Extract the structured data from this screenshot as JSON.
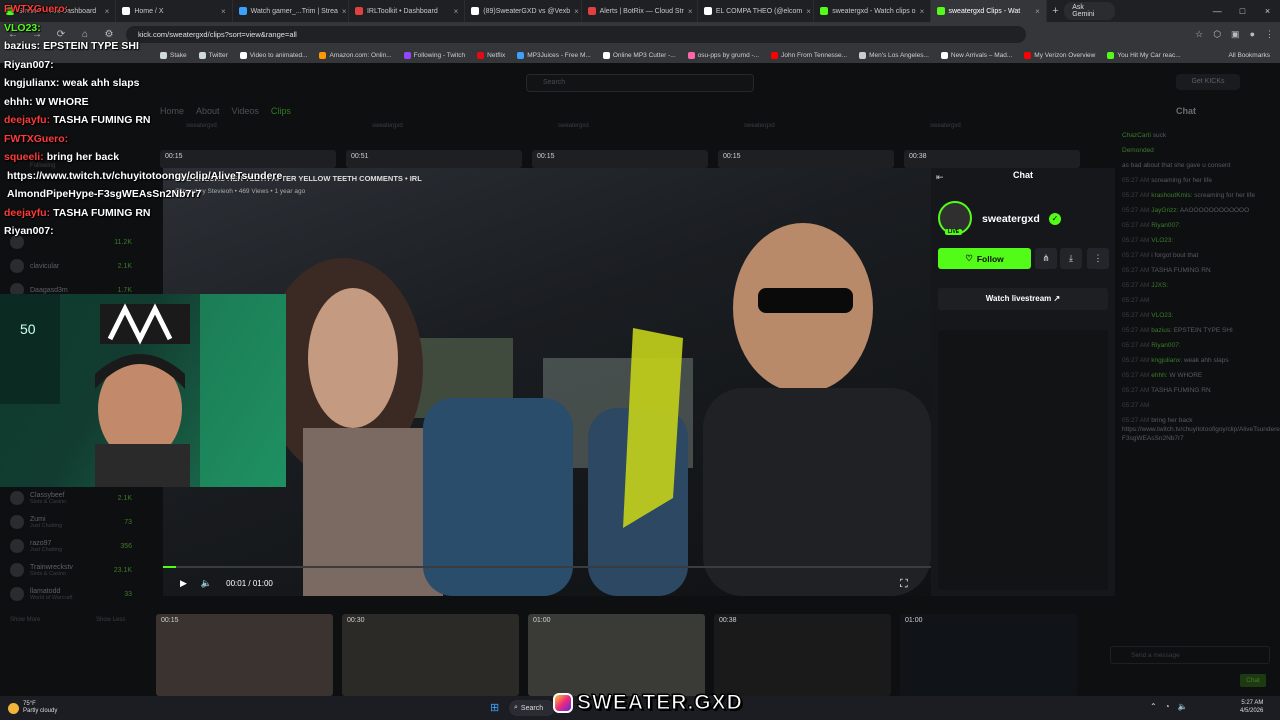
{
  "browser": {
    "tabs": [
      {
        "label": "Stream - Kick Dashboard",
        "color": "#53fc18"
      },
      {
        "label": "Home / X",
        "color": "#ffffff"
      },
      {
        "label": "Watch gamer_...Trim | Strea",
        "color": "#3aa1ff"
      },
      {
        "label": "IRLToolkit • Dashboard",
        "color": "#e04040"
      },
      {
        "label": "(89)SweaterGXD vs @Vexb",
        "color": "#ffffff"
      },
      {
        "label": "Alerts | BotRix — Cloud Str",
        "color": "#e04040"
      },
      {
        "label": "EL COMPA THEO (@elcom",
        "color": "#ffffff"
      },
      {
        "label": "sweatergxd - Watch clips o",
        "color": "#53fc18"
      },
      {
        "label": "sweatergxd Clips - Wat",
        "color": "#53fc18"
      }
    ],
    "ask_gemini": "Ask Gemini",
    "url": "kick.com/sweatergxd/clips?sort=view&range=all",
    "bookmarks": [
      {
        "label": "Stake",
        "color": "#cfd8dc"
      },
      {
        "label": "Twitter",
        "color": "#cfd8dc"
      },
      {
        "label": "Video to animated...",
        "color": "#ffffff"
      },
      {
        "label": "Amazon.com: Onlin...",
        "color": "#ff9900"
      },
      {
        "label": "Following - Twitch",
        "color": "#9146ff"
      },
      {
        "label": "Netflix",
        "color": "#e50914"
      },
      {
        "label": "MP3Juices - Free M...",
        "color": "#3aa1ff"
      },
      {
        "label": "Online MP3 Cutter -...",
        "color": "#ffffff"
      },
      {
        "label": "osu-pps by grumd -...",
        "color": "#ff66aa"
      },
      {
        "label": "John From Tennesse...",
        "color": "#ff0000"
      },
      {
        "label": "Men's Los Angeles...",
        "color": "#cccccc"
      },
      {
        "label": "New Arrivals – Mad...",
        "color": "#ffffff"
      },
      {
        "label": "My Verizon Overview",
        "color": "#ff0000"
      },
      {
        "label": "You Hit My Car reac...",
        "color": "#53fc18"
      }
    ],
    "all_bookmarks": "All Bookmarks"
  },
  "kick": {
    "search_placeholder": "Search",
    "get_kicks": "Get KICKs",
    "nav": [
      "Home",
      "About",
      "Videos",
      "Clips"
    ],
    "chat_title": "Chat",
    "browse": "Browse",
    "following": "Following",
    "top_thumbs": [
      {
        "duration": "00:15",
        "channel": "sweatergxd"
      },
      {
        "duration": "00:51",
        "channel": "sweatergxd"
      },
      {
        "duration": "00:15",
        "channel": "sweatergxd"
      },
      {
        "duration": "00:15",
        "channel": "sweatergxd"
      },
      {
        "duration": "00:38",
        "channel": "sweatergxd"
      }
    ],
    "bottom_thumbs": [
      {
        "duration": "00:15"
      },
      {
        "duration": "00:30"
      },
      {
        "duration": "01:00"
      },
      {
        "duration": "00:38"
      },
      {
        "duration": "01:00"
      }
    ],
    "sidebar": [
      {
        "name": "",
        "count": "11.2K",
        "sub": ""
      },
      {
        "name": "clavicular",
        "count": "2.1K",
        "sub": ""
      },
      {
        "name": "Daagasd3m",
        "count": "1.7K",
        "sub": ""
      },
      {
        "name": "Classybeef",
        "count": "2.1K",
        "sub": "Slots & Casino"
      },
      {
        "name": "Zumi",
        "count": "73",
        "sub": "Just Chatting"
      },
      {
        "name": "razo97",
        "count": "356",
        "sub": "Just Chatting"
      },
      {
        "name": "Trainwreckstv",
        "count": "23.1K",
        "sub": "Slots & Casino"
      },
      {
        "name": "llamatodd",
        "count": "33",
        "sub": "World of Warcraft"
      }
    ],
    "show_more": "Show More",
    "show_less": "Show Less"
  },
  "overlay_chat": [
    {
      "user": "FWTXGuero:",
      "msg": "",
      "color": "#ff3b3b"
    },
    {
      "user": "VLO23:",
      "msg": "",
      "color": "#53fc18"
    },
    {
      "user": "bazius:",
      "msg": "EPSTEIN TYPE SHI",
      "color": "#ffffff"
    },
    {
      "user": "Riyan007:",
      "msg": "",
      "color": "#ffffff"
    },
    {
      "user": "kngjulianx:",
      "msg": "weak ahh slaps",
      "color": "#ffffff"
    },
    {
      "user": "ehhh:",
      "msg": "W WHORE",
      "color": "#ffffff"
    },
    {
      "user": "deejayfu:",
      "msg": "TASHA FUMING RN",
      "color": "#ff3b3b"
    },
    {
      "user": "FWTXGuero:",
      "msg": "",
      "color": "#ff3b3b"
    },
    {
      "user": "squeeli:",
      "msg": "bring her back",
      "color": "#ff3b3b"
    },
    {
      "user": "",
      "msg": "https://www.twitch.tv/chuyitotoongy/clip/AliveTsundere",
      "color": "#ffffff"
    },
    {
      "user": "",
      "msg": "AlmondPipeHype-F3sgWEAsSn2Nb7r7",
      "color": "#ffffff"
    },
    {
      "user": "deejayfu:",
      "msg": "TASHA FUMING RN",
      "color": "#ff3b3b"
    },
    {
      "user": "Riyan007:",
      "msg": "",
      "color": "#ffffff"
    }
  ],
  "video": {
    "title": "HOE CHECKS HER TEETH AFTER YELLOW TEETH COMMENTS • IRL",
    "meta": "Clipped by Stevieoh • 469 Views • 1 year ago",
    "time": "00:01 / 01:00",
    "progress": 0.017
  },
  "channel_card": {
    "header": "Chat",
    "name": "sweatergxd",
    "live": "LIVE",
    "follow": "Follow",
    "watch_livestream": "Watch livestream"
  },
  "right_chat": [
    {
      "time": "",
      "user": "ChazCarti",
      "msg": "suck"
    },
    {
      "time": "",
      "user": "Demonded",
      "msg": ""
    },
    {
      "time": "",
      "user": "",
      "msg": "as bad about that she gave u consent"
    },
    {
      "time": "05:27 AM",
      "user": "",
      "msg": "screaming for her life"
    },
    {
      "time": "05:27 AM",
      "user": "krashoutKmis:",
      "msg": "screaming for her life"
    },
    {
      "time": "05:27 AM",
      "user": "JayGrizz:",
      "msg": "AAOOOOOOOOOOOO"
    },
    {
      "time": "05:27 AM",
      "user": "Riyan007:",
      "msg": ""
    },
    {
      "time": "05:27 AM",
      "user": "VLO23:",
      "msg": ""
    },
    {
      "time": "05:27 AM",
      "user": "",
      "msg": "i forgot bout that"
    },
    {
      "time": "05:27 AM",
      "user": "",
      "msg": "TASHA FUMING RN"
    },
    {
      "time": "05:27 AM",
      "user": "JJXS:",
      "msg": ""
    },
    {
      "time": "05:27 AM",
      "user": "",
      "msg": ""
    },
    {
      "time": "05:27 AM",
      "user": "VLO23:",
      "msg": ""
    },
    {
      "time": "05:27 AM",
      "user": "bazius:",
      "msg": "EPSTEIN TYPE SHI"
    },
    {
      "time": "05:27 AM",
      "user": "Riyan007:",
      "msg": ""
    },
    {
      "time": "05:27 AM",
      "user": "kngjulianx:",
      "msg": "weak ahh slaps"
    },
    {
      "time": "05:27 AM",
      "user": "ehhh:",
      "msg": "W WHORE"
    },
    {
      "time": "05:27 AM",
      "user": "",
      "msg": "TASHA FUMING RN"
    },
    {
      "time": "05:27 AM",
      "user": "",
      "msg": ""
    },
    {
      "time": "05:27 AM",
      "user": "",
      "msg": "bring her back https://www.twitch.tv/chuyitotoofigoy/clip/AliveTsundereAlmondPipeHype-F3sgWEAsSn2Nb7r7"
    }
  ],
  "chat_input_placeholder": "Send a message",
  "chat_button": "Chat",
  "taskbar": {
    "temp": "75°F",
    "weather": "Partly cloudy",
    "search": "Search",
    "brand": "SWEATER.GXD",
    "time": "5:27 AM",
    "date": "4/5/2026"
  }
}
